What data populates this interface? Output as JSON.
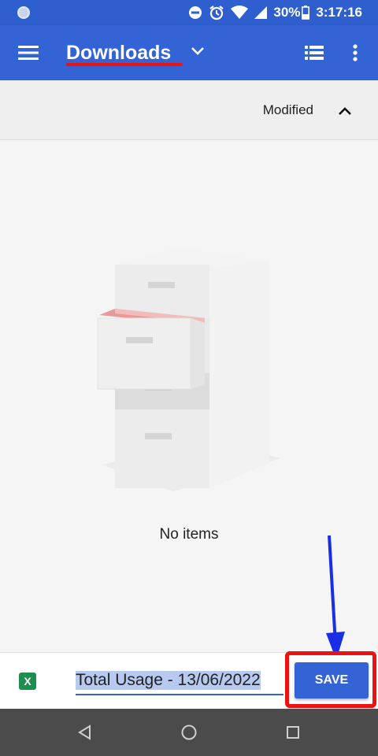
{
  "status_bar": {
    "battery": "30%",
    "time": "3:17:16",
    "icons": [
      "notification-dot-icon",
      "do-not-disturb-icon",
      "alarm-icon",
      "wifi-icon",
      "signal-icon",
      "battery-icon"
    ]
  },
  "app_bar": {
    "title": "Downloads",
    "icons": [
      "menu-icon",
      "chevron-down-icon",
      "list-view-icon",
      "more-vert-icon"
    ],
    "color": "#3463d6"
  },
  "sort": {
    "label": "Modified",
    "icon": "chevron-up-icon"
  },
  "empty_state": {
    "illustration": "file-cabinet-illustration",
    "message": "No items"
  },
  "save_bar": {
    "file_icon_text": "X",
    "filename": "Total Usage - 13/06/2022",
    "save_label": "SAVE"
  },
  "annotations": {
    "highlight_color": "#e11111",
    "arrow_color": "#1a2ee6"
  },
  "nav_bar": {
    "icons": [
      "back-icon",
      "home-icon",
      "recents-icon"
    ]
  }
}
